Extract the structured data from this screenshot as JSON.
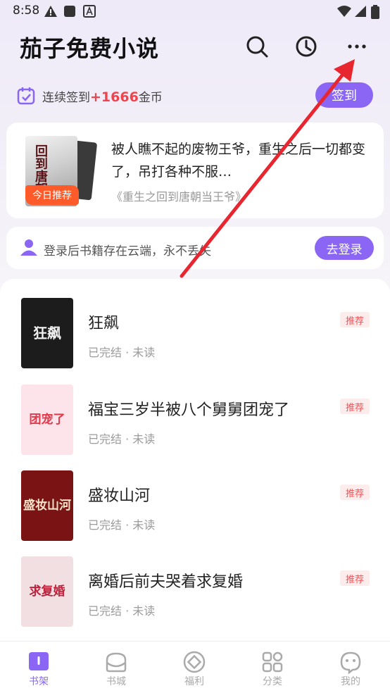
{
  "status_bar": {
    "time": "8:58"
  },
  "header": {
    "title": "茄子免费小说"
  },
  "checkin": {
    "prefix": "连续签到",
    "amount": "+1666",
    "suffix": "金币",
    "button": "签到"
  },
  "recommend": {
    "badge": "今日推荐",
    "cover_title": "回到唐朝",
    "description": "被人瞧不起的废物王爷，重生之后一切都变了，吊打各种不服…",
    "source": "《重生之回到唐朝当王爷》"
  },
  "login": {
    "text": "登录后书籍存在云端，永不丢失",
    "button": "去登录"
  },
  "books": [
    {
      "title": "狂飙",
      "status": "已完结 · 未读",
      "tag": "推荐",
      "cover_text": "狂飙",
      "cover_bg": "#1c1c1c",
      "cover_fg": "#f2f2f2"
    },
    {
      "title": "福宝三岁半被八个舅舅团宠了",
      "status": "已完结 · 未读",
      "tag": "推荐",
      "cover_text": "团宠了",
      "cover_bg": "#fde3ea",
      "cover_fg": "#e23a4a"
    },
    {
      "title": "盛妆山河",
      "status": "已完结 · 未读",
      "tag": "推荐",
      "cover_text": "盛妆山河",
      "cover_bg": "#7a1414",
      "cover_fg": "#f6e2c6"
    },
    {
      "title": "离婚后前夫哭着求复婚",
      "status": "已完结 · 未读",
      "tag": "推荐",
      "cover_text": "求复婚",
      "cover_bg": "#f1dfe2",
      "cover_fg": "#c0203a"
    }
  ],
  "nav": [
    {
      "label": "书架",
      "icon": "bookshelf-icon",
      "active": true
    },
    {
      "label": "书城",
      "icon": "bookstore-icon",
      "active": false
    },
    {
      "label": "福利",
      "icon": "welfare-icon",
      "active": false
    },
    {
      "label": "分类",
      "icon": "category-icon",
      "active": false
    },
    {
      "label": "我的",
      "icon": "profile-icon",
      "active": false
    }
  ],
  "colors": {
    "accent": "#8b66f5",
    "highlight": "#f0434b",
    "badge": "#ff5a2a",
    "annotation": "#e8262f"
  }
}
